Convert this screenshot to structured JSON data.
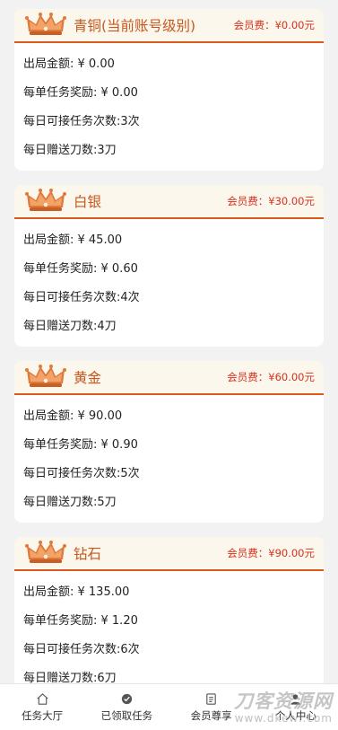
{
  "levels": [
    {
      "name": "青铜(当前账号级别)",
      "fee": "会员费：¥0.00元",
      "rows": [
        "出局金额: ¥ 0.00",
        "每单任务奖励: ¥ 0.00",
        "每日可接任务次数:3次",
        "每日赠送刀数:3刀"
      ]
    },
    {
      "name": "白银",
      "fee": "会员费：¥30.00元",
      "rows": [
        "出局金额: ¥ 45.00",
        "每单任务奖励: ¥ 0.60",
        "每日可接任务次数:4次",
        "每日赠送刀数:4刀"
      ]
    },
    {
      "name": "黄金",
      "fee": "会员费：¥60.00元",
      "rows": [
        "出局金额: ¥ 90.00",
        "每单任务奖励: ¥ 0.90",
        "每日可接任务次数:5次",
        "每日赠送刀数:5刀"
      ]
    },
    {
      "name": "钻石",
      "fee": "会员费：¥90.00元",
      "rows": [
        "出局金额: ¥ 135.00",
        "每单任务奖励: ¥ 1.20",
        "每日可接任务次数:6次",
        "每日赠送刀数:6刀"
      ]
    }
  ],
  "tabbar": [
    {
      "label": "任务大厅",
      "icon": "home-icon"
    },
    {
      "label": "已领取任务",
      "icon": "task-icon"
    },
    {
      "label": "会员尊享",
      "icon": "vip-icon"
    },
    {
      "label": "个人中心",
      "icon": "user-icon"
    }
  ],
  "watermark": {
    "title": "刀客资源网",
    "url": "www.dkewl.com"
  },
  "colors": {
    "accent": "#d85a1e",
    "fee": "#d9301c",
    "header_bg": "#fbf7ec"
  }
}
